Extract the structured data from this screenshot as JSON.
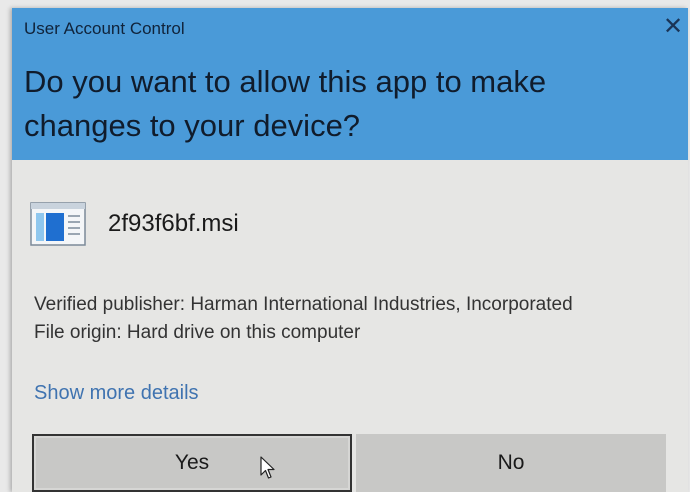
{
  "dialog": {
    "window_title": "User Account Control",
    "question": "Do you want to allow this app to make changes to your device?",
    "app_name": "2f93f6bf.msi",
    "publisher": "Verified publisher: Harman International Industries, Incorporated",
    "origin": "File origin: Hard drive on this computer",
    "more_details": "Show more details",
    "yes_label": "Yes",
    "no_label": "No"
  },
  "colors": {
    "header": "#4a9ad8",
    "body": "#e6e6e4",
    "link": "#3f73b0",
    "button": "#c8c8c6"
  },
  "icons": [
    "close-icon",
    "msi-installer-icon",
    "mouse-cursor-icon"
  ]
}
